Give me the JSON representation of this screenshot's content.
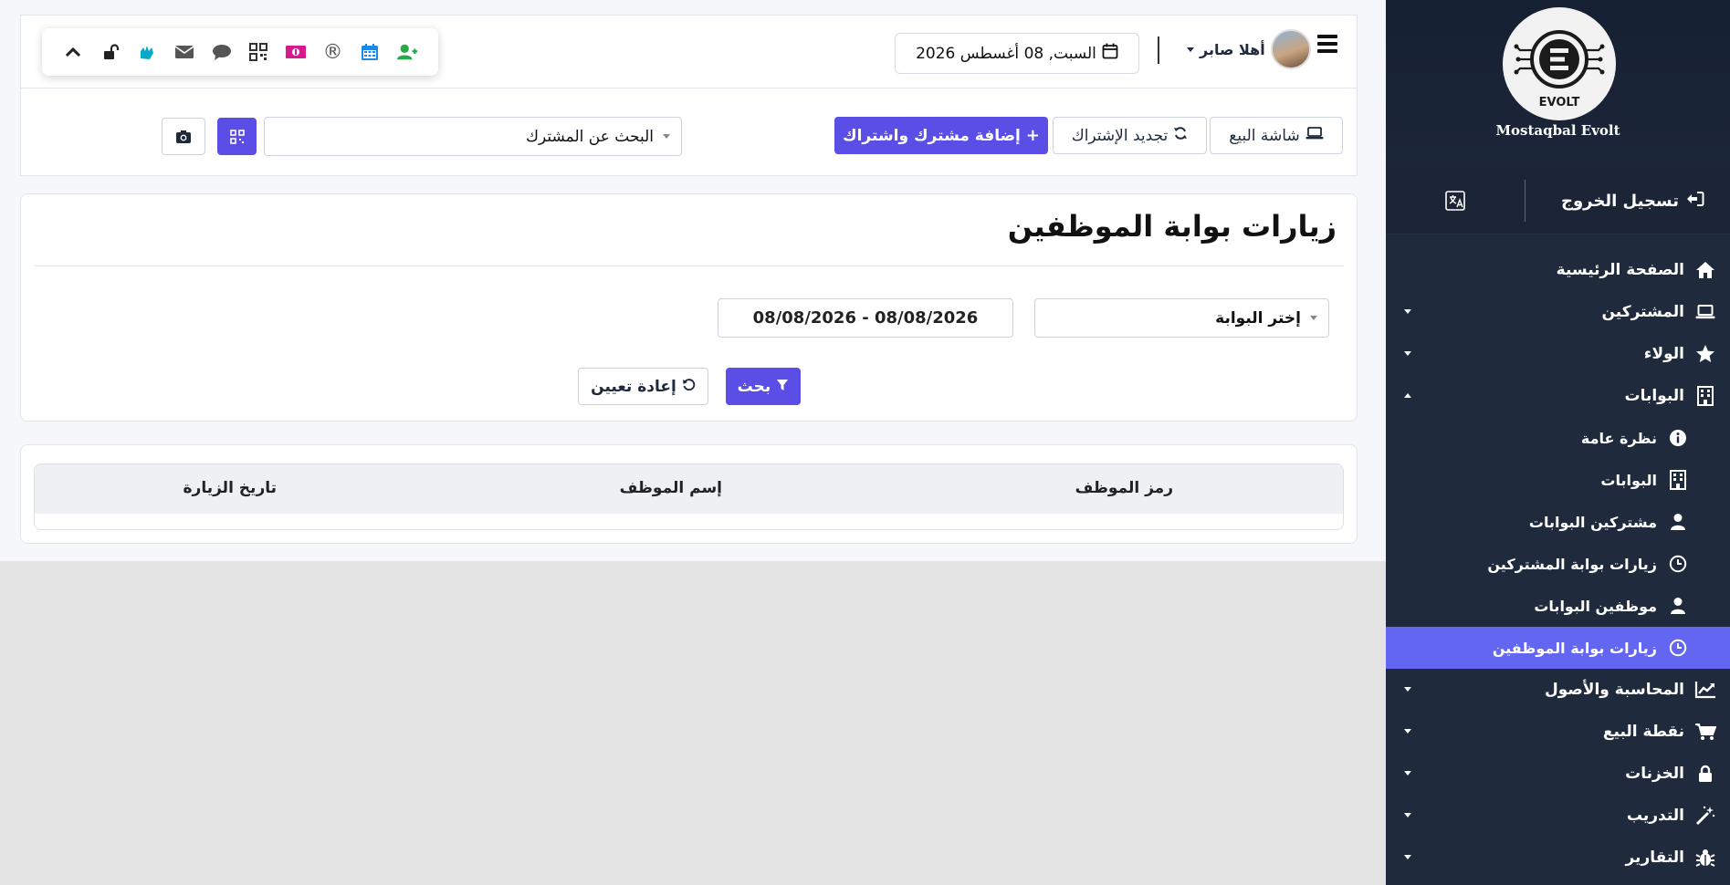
{
  "topbar": {
    "icons": [
      "chevron-up-icon",
      "unlock-icon",
      "sign-language-icon",
      "envelope-icon",
      "comment-icon",
      "qrcode-icon",
      "money-bill-icon",
      "registered-icon",
      "calendar-icon",
      "user-plus-icon"
    ],
    "date_label": "السبت, 08 أغسطس 2026",
    "user_label": "أهلا صابر",
    "registered_symbol": "®"
  },
  "actions": {
    "pos_screen": "شاشة البيع",
    "renew_subscription": "تجديد الإشتراك",
    "add_subscriber": "إضافة مشترك واشتراك",
    "search_subscriber_placeholder": "البحث عن المشترك"
  },
  "filter": {
    "title": "زيارات بوابة الموظفين",
    "gate_select": "إختر البوابة",
    "date_range": "08/08/2026 - 08/08/2026",
    "search_button": "بحث",
    "reset_button": "إعادة تعيين"
  },
  "table": {
    "columns": [
      "رمز الموظف",
      "إسم الموظف",
      "تاريخ الزيارة"
    ]
  },
  "sidebar": {
    "brand_name": "Mostaqbal Evolt",
    "logo_text": "EVOLT",
    "logout": "تسجيل الخروج",
    "items": [
      {
        "label": "الصفحة الرئيسية",
        "icon": "home-icon"
      },
      {
        "label": "المشتركين",
        "icon": "laptop-icon"
      },
      {
        "label": "الولاء",
        "icon": "star-icon"
      },
      {
        "label": "البوابات",
        "icon": "building-icon"
      },
      {
        "label": "نظرة عامة",
        "icon": "info-circle-icon"
      },
      {
        "label": "البوابات",
        "icon": "building-icon"
      },
      {
        "label": "مشتركين البوابات",
        "icon": "user-icon"
      },
      {
        "label": "زيارات بوابة المشتركين",
        "icon": "clock-icon"
      },
      {
        "label": "موظفين البوابات",
        "icon": "user-icon"
      },
      {
        "label": "زيارات بوابة الموظفين",
        "icon": "clock-icon"
      },
      {
        "label": "المحاسبة والأصول",
        "icon": "chart-line-icon"
      },
      {
        "label": "نقطة البيع",
        "icon": "shopping-cart-icon"
      },
      {
        "label": "الخزنات",
        "icon": "lock-icon"
      },
      {
        "label": "التدريب",
        "icon": "magic-wand-icon"
      },
      {
        "label": "التقارير",
        "icon": "bug-icon"
      }
    ]
  },
  "colors": {
    "primary": "#5a4ee6",
    "sidebar_bg": "#1f2a3c",
    "sidebar_active": "#6366f1"
  }
}
